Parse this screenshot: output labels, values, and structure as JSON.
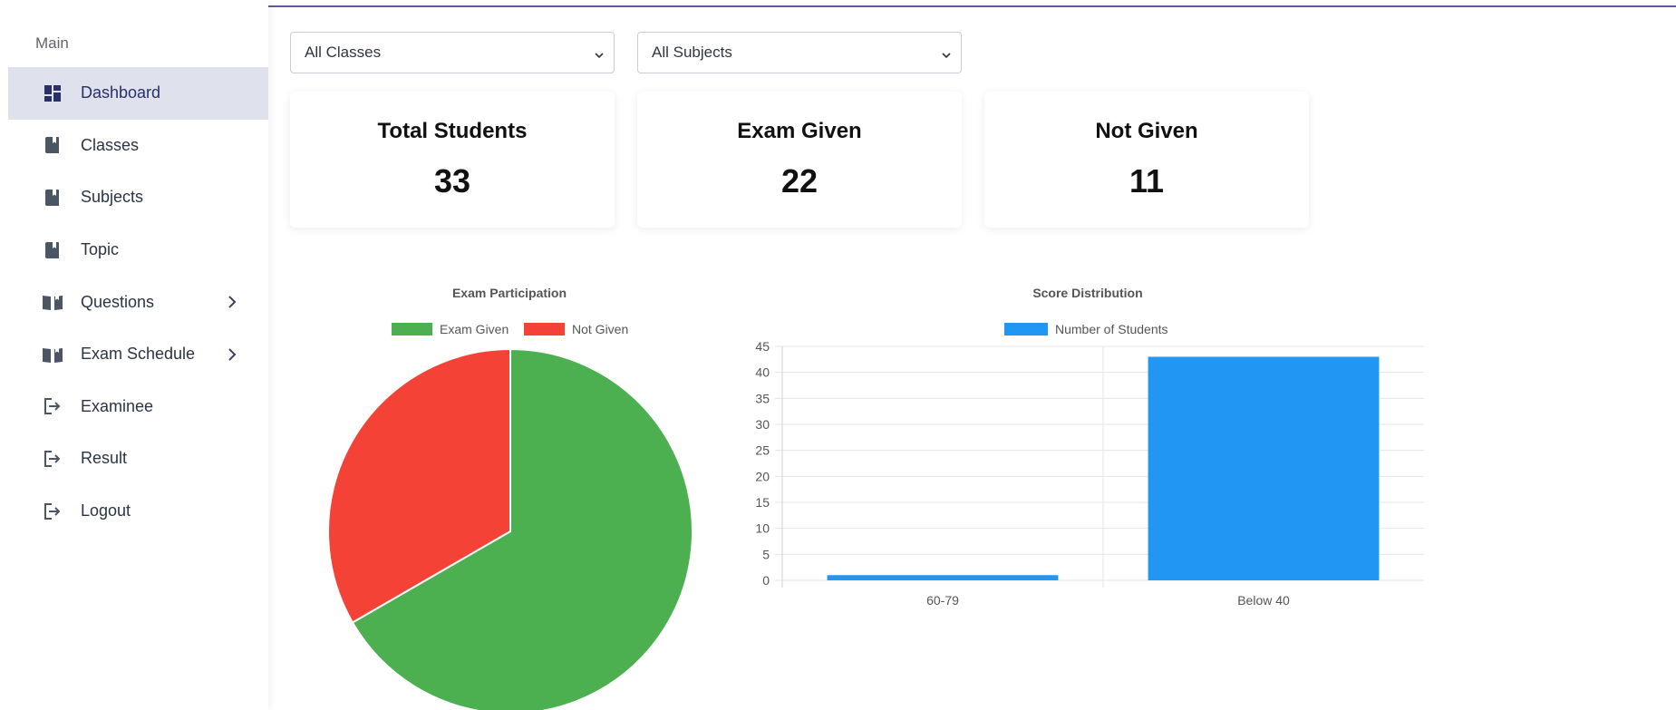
{
  "sidebar": {
    "section_label": "Main",
    "items": [
      {
        "label": "Dashboard",
        "icon": "dashboard-icon",
        "active": true,
        "has_chevron": false
      },
      {
        "label": "Classes",
        "icon": "book-icon",
        "active": false,
        "has_chevron": false
      },
      {
        "label": "Subjects",
        "icon": "book-icon",
        "active": false,
        "has_chevron": false
      },
      {
        "label": "Topic",
        "icon": "book-icon",
        "active": false,
        "has_chevron": false
      },
      {
        "label": "Questions",
        "icon": "open-book-icon",
        "active": false,
        "has_chevron": true
      },
      {
        "label": "Exam Schedule",
        "icon": "open-book-icon",
        "active": false,
        "has_chevron": true
      },
      {
        "label": "Examinee",
        "icon": "logout-icon",
        "active": false,
        "has_chevron": false
      },
      {
        "label": "Result",
        "icon": "logout-icon",
        "active": false,
        "has_chevron": false
      },
      {
        "label": "Logout",
        "icon": "logout-icon",
        "active": false,
        "has_chevron": false
      }
    ]
  },
  "filters": {
    "class_select": "All Classes",
    "subject_select": "All Subjects"
  },
  "stats": {
    "total_students": {
      "label": "Total Students",
      "value": "33"
    },
    "exam_given": {
      "label": "Exam Given",
      "value": "22"
    },
    "not_given": {
      "label": "Not Given",
      "value": "11"
    }
  },
  "colors": {
    "accent": "#27306a",
    "active_bg": "#dfe1ec",
    "exam_given": "#4caf50",
    "not_given": "#f44336",
    "bar": "#2196f3"
  },
  "chart_data": [
    {
      "type": "pie",
      "title": "Exam Participation",
      "categories": [
        "Exam Given",
        "Not Given"
      ],
      "values": [
        22,
        11
      ],
      "colors": [
        "#4caf50",
        "#f44336"
      ],
      "legend": "top"
    },
    {
      "type": "bar",
      "title": "Score Distribution",
      "categories": [
        "60-79",
        "Below 40"
      ],
      "series": [
        {
          "name": "Number of Students",
          "values": [
            1,
            43
          ]
        }
      ],
      "ylim": [
        0,
        45
      ],
      "yticks": [
        0,
        5,
        10,
        15,
        20,
        25,
        30,
        35,
        40,
        45
      ],
      "grid": true,
      "legend": "top",
      "color": "#2196f3"
    }
  ]
}
